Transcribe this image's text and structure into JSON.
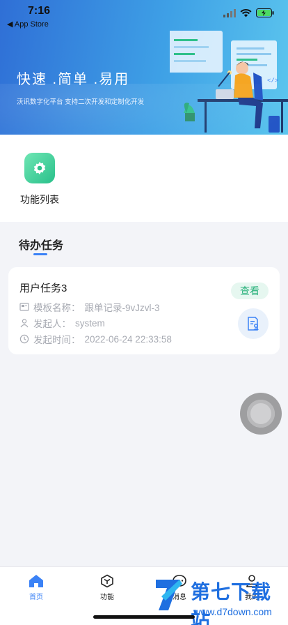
{
  "status": {
    "time": "7:16",
    "back_app": "◀ App Store"
  },
  "banner": {
    "title": "快速 .简单 .易用",
    "subtitle": "沃讯数字化平台 支持二次开发和定制化开发"
  },
  "functions": [
    {
      "label": "功能列表",
      "icon": "gear-icon"
    }
  ],
  "todo": {
    "title": "待办任务",
    "tasks": [
      {
        "name": "用户任务3",
        "template_label": "模板名称：",
        "template_value": "跟单记录-9vJzvl-3",
        "initiator_label": "发起人：",
        "initiator_value": "system",
        "time_label": "发起时间：",
        "time_value": "2022-06-24 22:33:58",
        "action": "查看"
      }
    ]
  },
  "tabbar": {
    "items": [
      {
        "label": "首页"
      },
      {
        "label": "功能"
      },
      {
        "label": "消息"
      },
      {
        "label": "我的"
      }
    ]
  },
  "watermark": {
    "name": "第七下载站",
    "url": "www.d7down.com"
  },
  "colors": {
    "accent": "#3b82f6",
    "success": "#2bb27c",
    "banner_start": "#2f6fd6",
    "banner_end": "#5cc6ee"
  }
}
